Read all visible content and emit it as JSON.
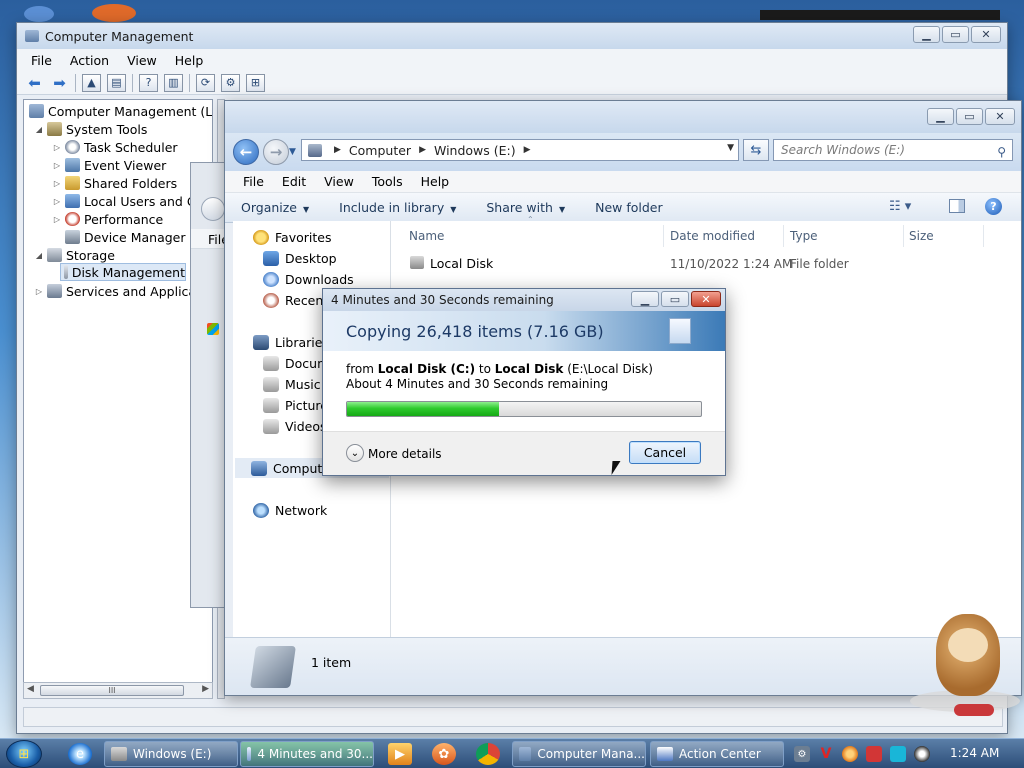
{
  "computer_management": {
    "title": "Computer Management",
    "menu": [
      "File",
      "Action",
      "View",
      "Help"
    ],
    "tree": [
      {
        "label": "Computer Management (Local",
        "level": 0
      },
      {
        "label": "System Tools",
        "level": 1
      },
      {
        "label": "Task Scheduler",
        "level": 2
      },
      {
        "label": "Event Viewer",
        "level": 2
      },
      {
        "label": "Shared Folders",
        "level": 2
      },
      {
        "label": "Local Users and Gro",
        "level": 2
      },
      {
        "label": "Performance",
        "level": 2
      },
      {
        "label": "Device Manager",
        "level": 2
      },
      {
        "label": "Storage",
        "level": 1
      },
      {
        "label": "Disk Management",
        "level": 2,
        "selected": true
      },
      {
        "label": "Services and Application",
        "level": 1
      }
    ],
    "scroll_grip": "III"
  },
  "ghost_window": {
    "menu_label": "File"
  },
  "explorer": {
    "address": [
      "Computer",
      "Windows (E:)"
    ],
    "search_placeholder": "Search Windows (E:)",
    "menu": [
      "File",
      "Edit",
      "View",
      "Tools",
      "Help"
    ],
    "commands": [
      {
        "label": "Organize",
        "dropdown": true
      },
      {
        "label": "Include in library",
        "dropdown": true
      },
      {
        "label": "Share with",
        "dropdown": true
      },
      {
        "label": "New folder",
        "dropdown": false
      }
    ],
    "nav": {
      "favorites": "Favorites",
      "desktop": "Desktop",
      "downloads": "Downloads",
      "recent": "Recent",
      "libraries": "Libraries",
      "documents": "Docum",
      "music": "Music",
      "pictures": "Picture",
      "videos": "Videos",
      "computer": "Compute",
      "network": "Network"
    },
    "columns": [
      "Name",
      "Date modified",
      "Type",
      "Size"
    ],
    "rows": [
      {
        "name": "Local Disk",
        "date": "11/10/2022 1:24 AM",
        "type": "File folder",
        "size": ""
      }
    ],
    "status": "1 item"
  },
  "copy_dialog": {
    "title": "4 Minutes and 30 Seconds remaining",
    "heading": "Copying 26,418 items (7.16 GB)",
    "from_prefix": "from ",
    "source": "Local Disk (C:)",
    "to_word": " to ",
    "dest": "Local Disk",
    "dest_path": " (E:\\Local Disk)",
    "remaining": "About 4 Minutes and 30 Seconds remaining",
    "progress_fraction": 0.43,
    "more_details": "More details",
    "cancel": "Cancel"
  },
  "taskbar": {
    "tasks": [
      {
        "label": "Windows (E:)",
        "active": false
      },
      {
        "label": "4 Minutes and 30...",
        "active": true
      },
      {
        "label": "Computer Mana...",
        "active": false
      },
      {
        "label": "Action Center",
        "active": false
      }
    ],
    "tray_letter": "V",
    "clock": "1:24 AM"
  },
  "colors": {
    "accent": "#3b7ab7",
    "progress_green": "#2ecb2e"
  }
}
